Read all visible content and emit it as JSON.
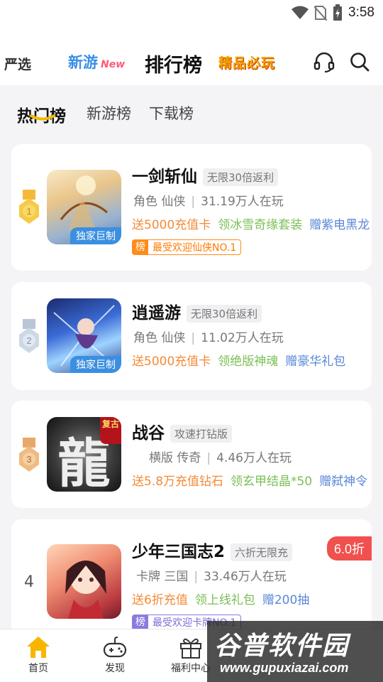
{
  "status_bar": {
    "time": "3:58"
  },
  "top_nav": {
    "yanxuan": "严选",
    "xinyou": "新游",
    "xinyou_new": "New",
    "rank": "排行榜",
    "jingpin": "精品必玩"
  },
  "tabs": [
    "热门榜",
    "新游榜",
    "下载榜"
  ],
  "games": [
    {
      "rank": "1",
      "title": "一剑斩仙",
      "tag": "无限30倍返利",
      "genre": "角色 仙侠",
      "players": "31.19万人在玩",
      "perks": [
        "送5000充值卡",
        "领冰雪奇缘套装",
        "赠紫电黑龙"
      ],
      "badge": "独家巨制",
      "rank_badge_label": "榜",
      "rank_badge_text": "最受欢迎仙侠NO.1"
    },
    {
      "rank": "2",
      "title": "逍遥游",
      "tag": "无限30倍返利",
      "genre": "角色 仙侠",
      "players": "11.02万人在玩",
      "perks": [
        "送5000充值卡",
        "领绝版神魂",
        "赠豪华礼包"
      ],
      "badge": "独家巨制"
    },
    {
      "rank": "3",
      "title": "战谷",
      "tag": "攻速打钻版",
      "genre": "横版 传奇",
      "players": "4.46万人在玩",
      "perks": [
        "送5.8万充值钻石",
        "领玄甲结晶*50",
        "赠弑神令"
      ],
      "thumb_char": "龍",
      "thumb_corner": "复古"
    },
    {
      "rank": "4",
      "title": "少年三国志2",
      "tag": "六折无限充",
      "genre": "卡牌 三国",
      "players": "33.46万人在玩",
      "perks": [
        "送6折充值",
        "领上线礼包",
        "赠200抽"
      ],
      "discount": "6.0折",
      "rank_badge_label": "榜",
      "rank_badge_text": "最受欢迎卡牌NO.1"
    }
  ],
  "bottom_bar": [
    "首页",
    "发现",
    "福利中心"
  ],
  "watermark": {
    "title": "谷普软件园",
    "url": "www.gupuxiazai.com"
  },
  "colors": {
    "accent": "#f5a300",
    "perk_orange": "#f58a36",
    "perk_green": "#7bbf55",
    "perk_blue": "#5a86d8",
    "discount": "#f0504e"
  }
}
